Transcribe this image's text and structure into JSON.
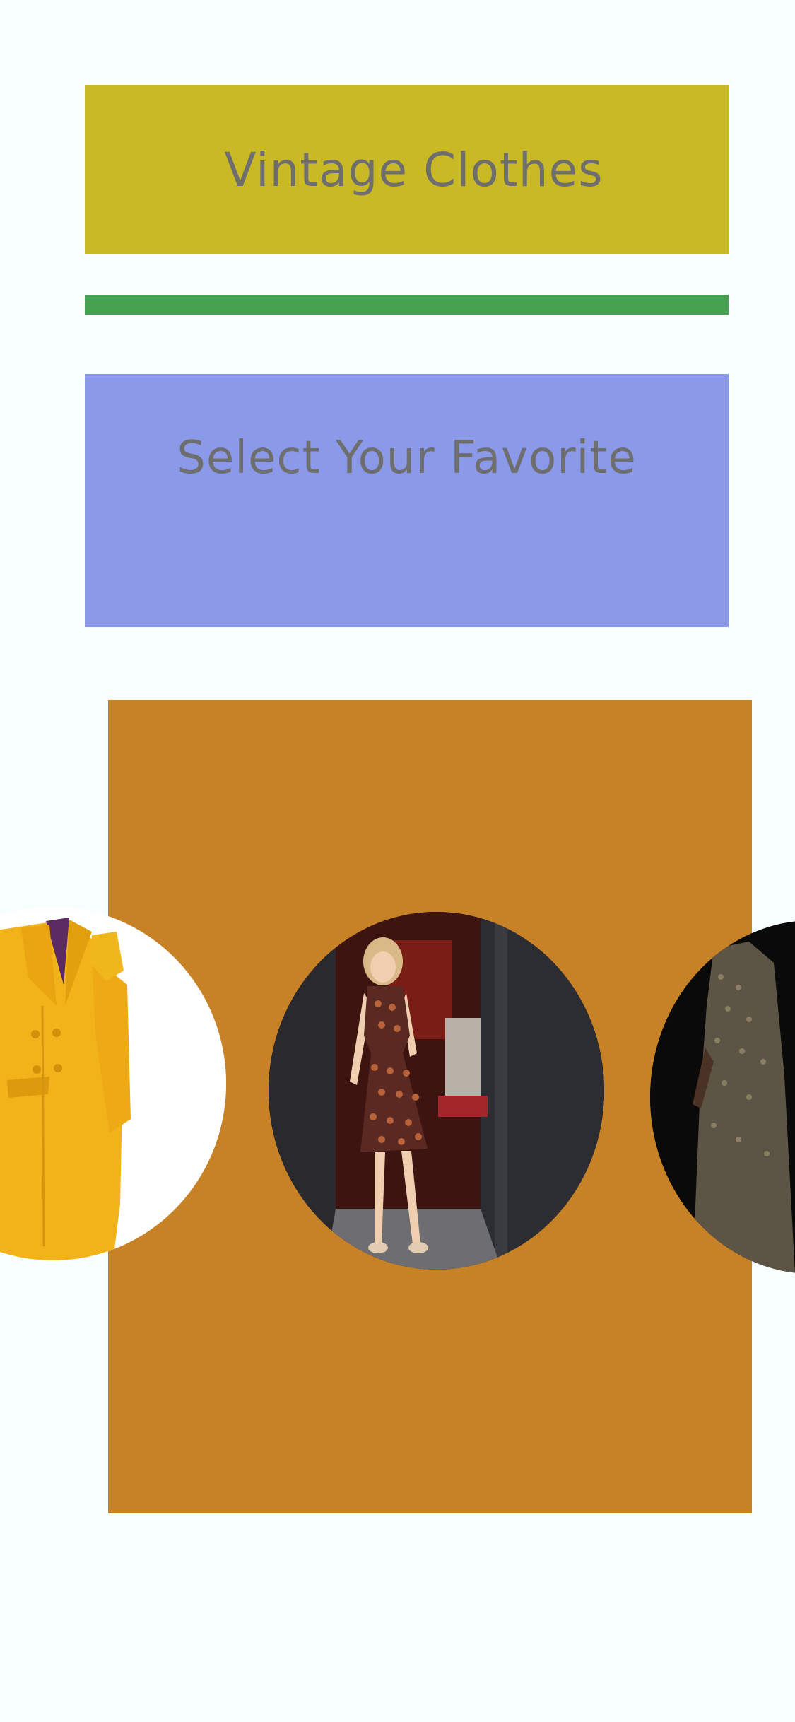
{
  "header": {
    "title": "Vintage Clothes"
  },
  "section": {
    "subtitle": "Select Your Favorite"
  },
  "colors": {
    "page_background": "#f8fefd",
    "title_box": "#c9ba25",
    "divider": "#46a151",
    "subtitle_box": "#8a9ae8",
    "carousel_panel": "#c78227",
    "text": "#6e6e6e"
  },
  "carousel": {
    "items": [
      {
        "name": "yellow-coat-photo"
      },
      {
        "name": "patterned-dress-photo"
      },
      {
        "name": "sequin-dress-photo"
      }
    ]
  }
}
